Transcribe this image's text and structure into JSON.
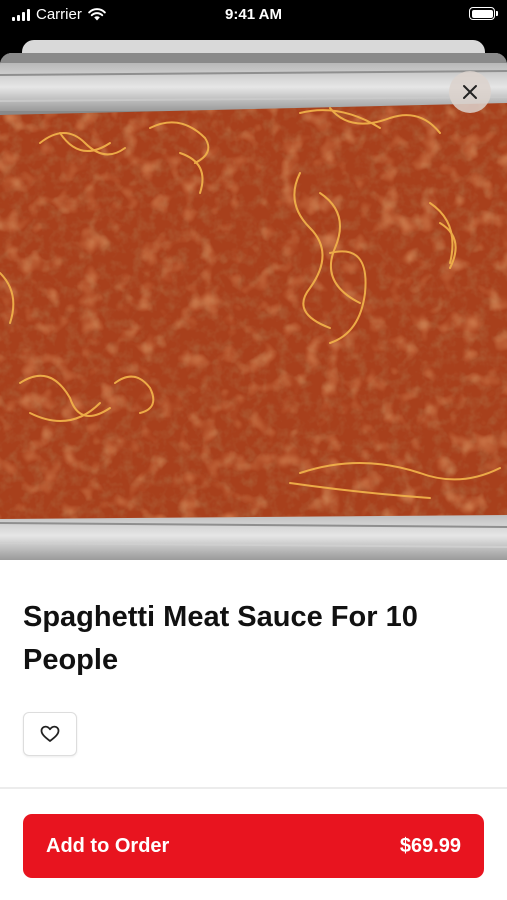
{
  "status_bar": {
    "carrier": "Carrier",
    "time": "9:41 AM"
  },
  "product": {
    "title": "Spaghetti Meat Sauce For 10 People",
    "image_alt": "Tray of spaghetti with meat sauce"
  },
  "actions": {
    "add_label": "Add to Order",
    "price": "$69.99"
  },
  "colors": {
    "accent": "#e8141f"
  },
  "icons": {
    "close": "close-icon",
    "favorite": "heart-icon"
  }
}
